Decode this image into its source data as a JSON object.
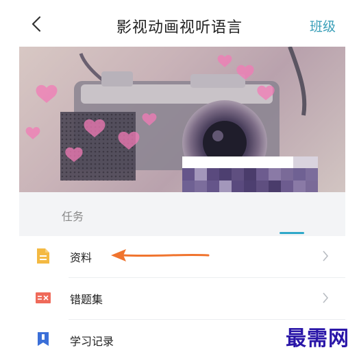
{
  "header": {
    "title": "影视动画视听语言",
    "right_link": "班级",
    "back_icon": "chevron-left-icon"
  },
  "banner": {
    "image": "vintage-camera-with-pink-hearts",
    "redacted": true
  },
  "tabs": {
    "items": [
      {
        "label": "任务"
      }
    ],
    "active_index": 1,
    "accent_color": "#2fa8c9"
  },
  "list": {
    "items": [
      {
        "label": "资料",
        "icon": "document-icon",
        "icon_color": "#f4b942"
      },
      {
        "label": "错题集",
        "icon": "wrong-answers-icon",
        "icon_color": "#ef6a5a"
      },
      {
        "label": "学习记录",
        "icon": "bookmark-icon",
        "icon_color": "#3b6fd8"
      }
    ]
  },
  "annotation": {
    "arrow_color": "#f0742e"
  },
  "watermark": {
    "text": "最需网",
    "color": "#2a16a8"
  }
}
